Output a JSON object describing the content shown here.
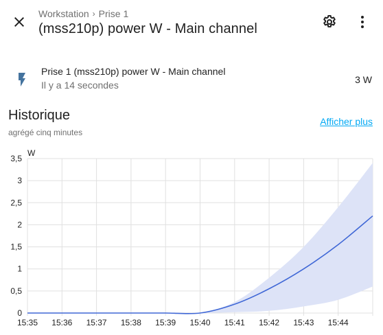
{
  "header": {
    "breadcrumb": [
      "Workstation",
      "Prise 1"
    ],
    "title": "(mss210p) power W - Main channel",
    "icons": {
      "close": "close-icon",
      "settings": "gear-icon",
      "more": "more-vert-icon"
    }
  },
  "entity": {
    "icon": "flash-icon",
    "name": "Prise 1 (mss210p) power W - Main channel",
    "last_changed": "Il y a 14 secondes",
    "state": "3 W"
  },
  "history": {
    "title": "Historique",
    "subtitle": "agrégé cinq minutes",
    "show_more": "Afficher plus"
  },
  "colors": {
    "accent": "#03a9f4",
    "line": "#3f67d6",
    "band": "#dde3f7"
  },
  "chart_data": {
    "type": "area",
    "ylabel": "W",
    "xlabel": "",
    "title": "",
    "ylim": [
      0,
      3.5
    ],
    "y_ticks": [
      "0",
      "0,5",
      "1",
      "1,5",
      "2",
      "2,5",
      "3",
      "3,5"
    ],
    "x_ticks": [
      "15:35",
      "15:36",
      "15:37",
      "15:38",
      "15:39",
      "15:40",
      "15:41",
      "15:42",
      "15:43",
      "15:44"
    ],
    "x": [
      "15:35",
      "15:36",
      "15:37",
      "15:38",
      "15:39",
      "15:40",
      "15:41",
      "15:42",
      "15:43",
      "15:44",
      "15:45"
    ],
    "series": [
      {
        "values": [
          0,
          0,
          0,
          0,
          0,
          0,
          0.2,
          0.55,
          1.0,
          1.55,
          2.2
        ]
      }
    ],
    "band": {
      "lower": [
        0,
        0,
        0,
        0,
        0,
        0,
        0.02,
        0.05,
        0.15,
        0.3,
        0.6
      ],
      "upper": [
        0,
        0,
        0,
        0,
        0,
        0,
        0.25,
        0.8,
        1.5,
        2.4,
        3.4
      ]
    },
    "grid": true
  }
}
